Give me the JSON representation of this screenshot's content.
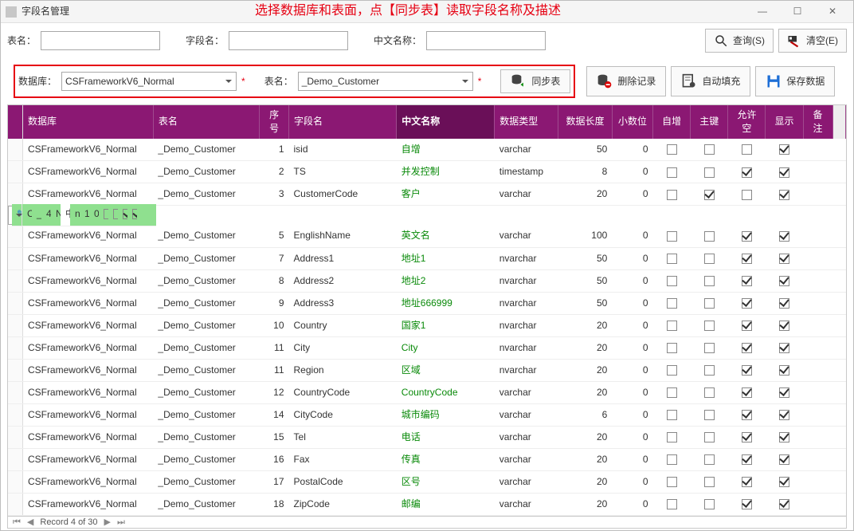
{
  "window": {
    "title": "字段名管理",
    "banner": "选择数据库和表面，点【同步表】读取字段名称及描述"
  },
  "filters": {
    "tbl_label": "表名：",
    "fld_label": "字段名：",
    "cn_label": "中文名称：",
    "tbl_value": "",
    "fld_value": "",
    "cn_value": "",
    "query_btn": "查询(S)",
    "clear_btn": "清空(E)"
  },
  "selects": {
    "db_label": "数据库：",
    "db_value": "CSFrameworkV6_Normal",
    "tbl_label": "表名：",
    "tbl_value": "_Demo_Customer",
    "sync_btn": "同步表",
    "del_btn": "删除记录",
    "autofill_btn": "自动填充",
    "save_btn": "保存数据"
  },
  "cols": {
    "db": "数据库",
    "tbl": "表名",
    "seq": "序号",
    "fld": "字段名",
    "cn": "中文名称",
    "type": "数据类型",
    "len": "数据长度",
    "dec": "小数位",
    "auto": "自增",
    "pk": "主键",
    "null": "允许空",
    "show": "显示",
    "rmk": "备注"
  },
  "selected_index": 3,
  "rows": [
    {
      "db": "CSFrameworkV6_Normal",
      "tbl": "_Demo_Customer",
      "seq": 1,
      "fld": "isid",
      "cn": "自增",
      "type": "varchar",
      "len": 50,
      "dec": 0,
      "auto": false,
      "pk": false,
      "null": false,
      "show": true
    },
    {
      "db": "CSFrameworkV6_Normal",
      "tbl": "_Demo_Customer",
      "seq": 2,
      "fld": "TS",
      "cn": "并发控制",
      "type": "timestamp",
      "len": 8,
      "dec": 0,
      "auto": false,
      "pk": false,
      "null": true,
      "show": true
    },
    {
      "db": "CSFrameworkV6_Normal",
      "tbl": "_Demo_Customer",
      "seq": 3,
      "fld": "CustomerCode",
      "cn": "客户",
      "type": "varchar",
      "len": 20,
      "dec": 0,
      "auto": false,
      "pk": true,
      "null": false,
      "show": true
    },
    {
      "db": "CSFrameworkV6_Normal",
      "tbl": "_Demo_Customer",
      "seq": 4,
      "fld": "NativeName",
      "cn": "中文名称",
      "type": "nvarchar",
      "len": 100,
      "dec": 0,
      "auto": false,
      "pk": false,
      "null": true,
      "show": true
    },
    {
      "db": "CSFrameworkV6_Normal",
      "tbl": "_Demo_Customer",
      "seq": 5,
      "fld": "EnglishName",
      "cn": "英文名",
      "type": "varchar",
      "len": 100,
      "dec": 0,
      "auto": false,
      "pk": false,
      "null": true,
      "show": true
    },
    {
      "db": "CSFrameworkV6_Normal",
      "tbl": "_Demo_Customer",
      "seq": 7,
      "fld": "Address1",
      "cn": "地址1",
      "type": "nvarchar",
      "len": 50,
      "dec": 0,
      "auto": false,
      "pk": false,
      "null": true,
      "show": true
    },
    {
      "db": "CSFrameworkV6_Normal",
      "tbl": "_Demo_Customer",
      "seq": 8,
      "fld": "Address2",
      "cn": "地址2",
      "type": "nvarchar",
      "len": 50,
      "dec": 0,
      "auto": false,
      "pk": false,
      "null": true,
      "show": true
    },
    {
      "db": "CSFrameworkV6_Normal",
      "tbl": "_Demo_Customer",
      "seq": 9,
      "fld": "Address3",
      "cn": "地址666999",
      "type": "nvarchar",
      "len": 50,
      "dec": 0,
      "auto": false,
      "pk": false,
      "null": true,
      "show": true
    },
    {
      "db": "CSFrameworkV6_Normal",
      "tbl": "_Demo_Customer",
      "seq": 10,
      "fld": "Country",
      "cn": "国家1",
      "type": "nvarchar",
      "len": 20,
      "dec": 0,
      "auto": false,
      "pk": false,
      "null": true,
      "show": true
    },
    {
      "db": "CSFrameworkV6_Normal",
      "tbl": "_Demo_Customer",
      "seq": 11,
      "fld": "City",
      "cn": "City",
      "type": "nvarchar",
      "len": 20,
      "dec": 0,
      "auto": false,
      "pk": false,
      "null": true,
      "show": true
    },
    {
      "db": "CSFrameworkV6_Normal",
      "tbl": "_Demo_Customer",
      "seq": 11,
      "fld": "Region",
      "cn": "区域",
      "type": "nvarchar",
      "len": 20,
      "dec": 0,
      "auto": false,
      "pk": false,
      "null": true,
      "show": true
    },
    {
      "db": "CSFrameworkV6_Normal",
      "tbl": "_Demo_Customer",
      "seq": 12,
      "fld": "CountryCode",
      "cn": "CountryCode",
      "type": "varchar",
      "len": 20,
      "dec": 0,
      "auto": false,
      "pk": false,
      "null": true,
      "show": true
    },
    {
      "db": "CSFrameworkV6_Normal",
      "tbl": "_Demo_Customer",
      "seq": 14,
      "fld": "CityCode",
      "cn": "城市编码",
      "type": "varchar",
      "len": 6,
      "dec": 0,
      "auto": false,
      "pk": false,
      "null": true,
      "show": true
    },
    {
      "db": "CSFrameworkV6_Normal",
      "tbl": "_Demo_Customer",
      "seq": 15,
      "fld": "Tel",
      "cn": "电话",
      "type": "varchar",
      "len": 20,
      "dec": 0,
      "auto": false,
      "pk": false,
      "null": true,
      "show": true
    },
    {
      "db": "CSFrameworkV6_Normal",
      "tbl": "_Demo_Customer",
      "seq": 16,
      "fld": "Fax",
      "cn": "传真",
      "type": "varchar",
      "len": 20,
      "dec": 0,
      "auto": false,
      "pk": false,
      "null": true,
      "show": true
    },
    {
      "db": "CSFrameworkV6_Normal",
      "tbl": "_Demo_Customer",
      "seq": 17,
      "fld": "PostalCode",
      "cn": "区号",
      "type": "varchar",
      "len": 20,
      "dec": 0,
      "auto": false,
      "pk": false,
      "null": true,
      "show": true
    },
    {
      "db": "CSFrameworkV6_Normal",
      "tbl": "_Demo_Customer",
      "seq": 18,
      "fld": "ZipCode",
      "cn": "邮编",
      "type": "varchar",
      "len": 20,
      "dec": 0,
      "auto": false,
      "pk": false,
      "null": true,
      "show": true
    }
  ],
  "nav": {
    "text": "Record 4 of 30"
  }
}
